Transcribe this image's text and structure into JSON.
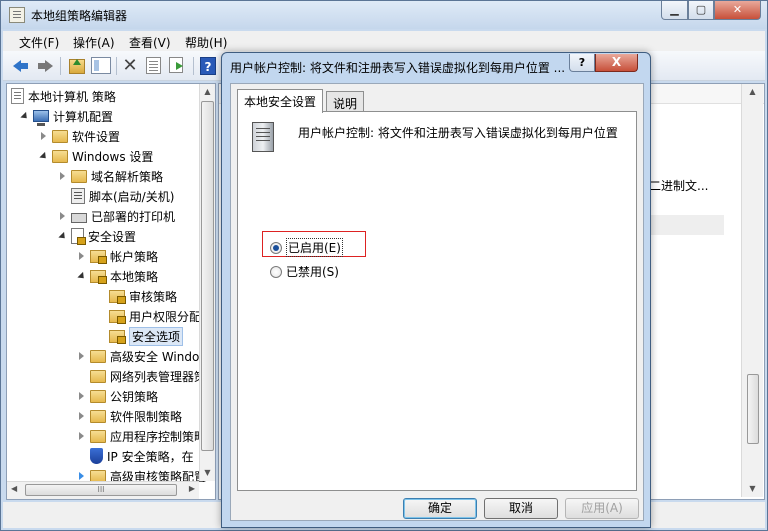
{
  "main": {
    "title": "本地组策略编辑器",
    "menu": [
      "文件(F)",
      "操作(A)",
      "查看(V)",
      "帮助(H)"
    ],
    "right_text": "二进制文..."
  },
  "tree": {
    "items": [
      {
        "label": "本地计算机 策略"
      },
      {
        "label": "计算机配置"
      },
      {
        "label": "软件设置"
      },
      {
        "label": "Windows 设置"
      },
      {
        "label": "域名解析策略"
      },
      {
        "label": "脚本(启动/关机)"
      },
      {
        "label": "已部署的打印机"
      },
      {
        "label": "安全设置"
      },
      {
        "label": "帐户策略"
      },
      {
        "label": "本地策略"
      },
      {
        "label": "审核策略"
      },
      {
        "label": "用户权限分配"
      },
      {
        "label": "安全选项"
      },
      {
        "label": "高级安全 Windo"
      },
      {
        "label": "网络列表管理器策"
      },
      {
        "label": "公钥策略"
      },
      {
        "label": "软件限制策略"
      },
      {
        "label": "应用程序控制策略"
      },
      {
        "label": "IP 安全策略，在"
      },
      {
        "label": "高级审核策略配置"
      }
    ],
    "hscroll_label": "III"
  },
  "dialog": {
    "title": "用户帐户控制: 将文件和注册表写入错误虚拟化到每用户位置 ...",
    "help": "?",
    "close": "X",
    "tabs": [
      "本地安全设置",
      "说明"
    ],
    "policy_name": "用户帐户控制: 将文件和注册表写入错误虚拟化到每用户位置",
    "enabled_label": "已启用(E)",
    "disabled_label": "已禁用(S)",
    "ok": "确定",
    "cancel": "取消",
    "apply": "应用(A)"
  }
}
